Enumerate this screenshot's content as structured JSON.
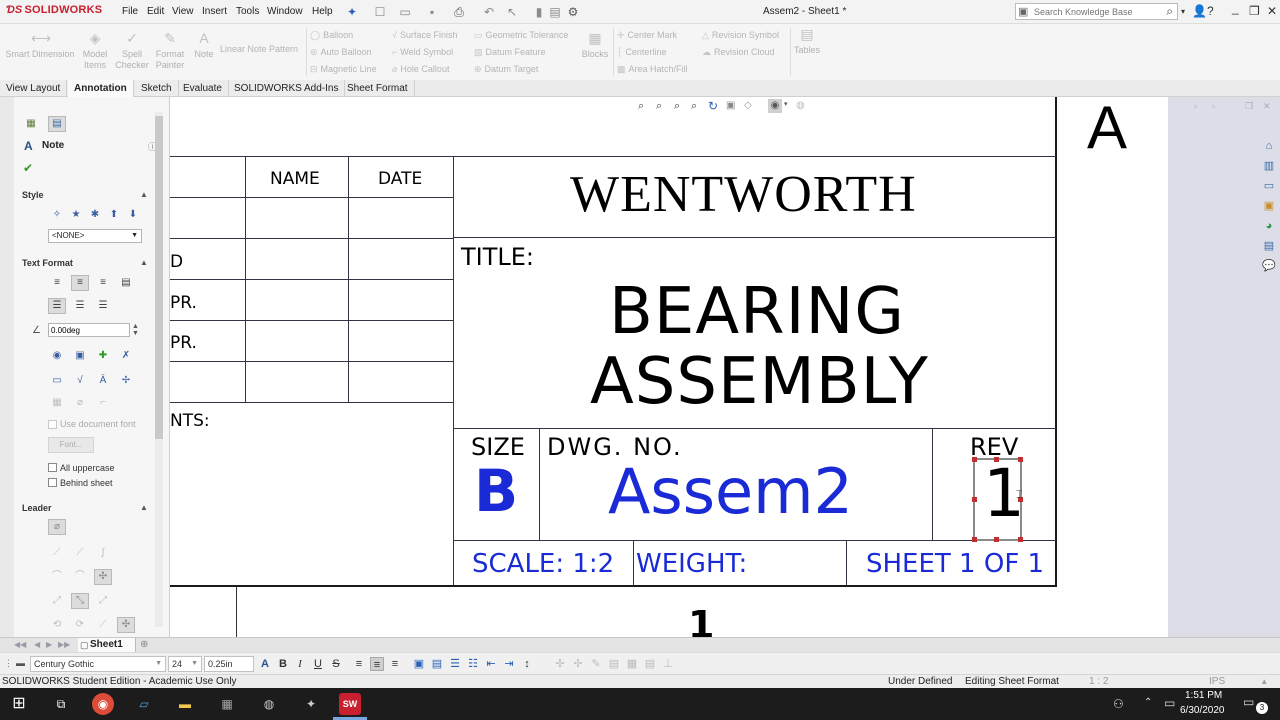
{
  "app": {
    "logo_text": "SOLIDWORKS",
    "document_title": "Assem2 - Sheet1 *",
    "menu": [
      "File",
      "Edit",
      "View",
      "Insert",
      "Tools",
      "Window",
      "Help"
    ],
    "search_placeholder": "Search Knowledge Base"
  },
  "ribbon": {
    "smart_dimension": "Smart Dimension",
    "model_items": [
      "Model",
      "Items"
    ],
    "spell_checker": [
      "Spell",
      "Checker"
    ],
    "format_painter": [
      "Format",
      "Painter"
    ],
    "note": "Note",
    "linear_note_pattern": "Linear Note Pattern",
    "col2": [
      "Balloon",
      "Auto Balloon",
      "Magnetic Line"
    ],
    "col3": [
      "Surface Finish",
      "Weld Symbol",
      "Hole Callout"
    ],
    "col4": [
      "Geometric Tolerance",
      "Datum Feature",
      "Datum Target"
    ],
    "blocks": "Blocks",
    "col5": [
      "Center Mark",
      "Centerline",
      "Area Hatch/Fill"
    ],
    "col6": [
      "Revision Symbol",
      "Revision Cloud"
    ],
    "tables": "Tables"
  },
  "tabs": [
    "View Layout",
    "Annotation",
    "Sketch",
    "Evaluate",
    "SOLIDWORKS Add-Ins",
    "Sheet Format"
  ],
  "panel": {
    "title": "Note",
    "style_label": "Style",
    "style_value": "<NONE>",
    "text_format_label": "Text Format",
    "angle_value": "0.00deg",
    "use_document_font": "Use document font",
    "font_button": "Font...",
    "all_uppercase": "All uppercase",
    "behind_sheet": "Behind sheet",
    "leader_label": "Leader"
  },
  "drawing": {
    "zone_letter": "A",
    "col_name": "NAME",
    "col_date": "DATE",
    "row_labels": [
      "D",
      "PR.",
      "PR."
    ],
    "comments_partial": "NTS:",
    "company": "WENTWORTH",
    "title_label": "TITLE:",
    "title_line1": "BEARING",
    "title_line2": "ASSEMBLY",
    "size_label": "SIZE",
    "size_value": "B",
    "dwg_no_label": "DWG.  NO.",
    "dwg_no_value": "Assem2",
    "rev_label": "REV",
    "rev_value": "1",
    "scale": "SCALE: 1:2",
    "weight": "WEIGHT:",
    "sheet": "SHEET 1 OF 1",
    "bottom_number": "1"
  },
  "sheet_tab": "Sheet1",
  "format_bar": {
    "font": "Century Gothic",
    "size": "24",
    "height": "0.25in"
  },
  "status": {
    "edition": "SOLIDWORKS Student Edition - Academic Use Only",
    "defined": "Under Defined",
    "mode": "Editing Sheet Format",
    "scale": "1 : 2",
    "units": "IPS"
  },
  "taskbar": {
    "time": "1:51 PM",
    "date": "6/30/2020",
    "notifications": "3"
  },
  "colors": {
    "accent_blue": "#1a2ad6",
    "brand_red": "#c8202f"
  }
}
